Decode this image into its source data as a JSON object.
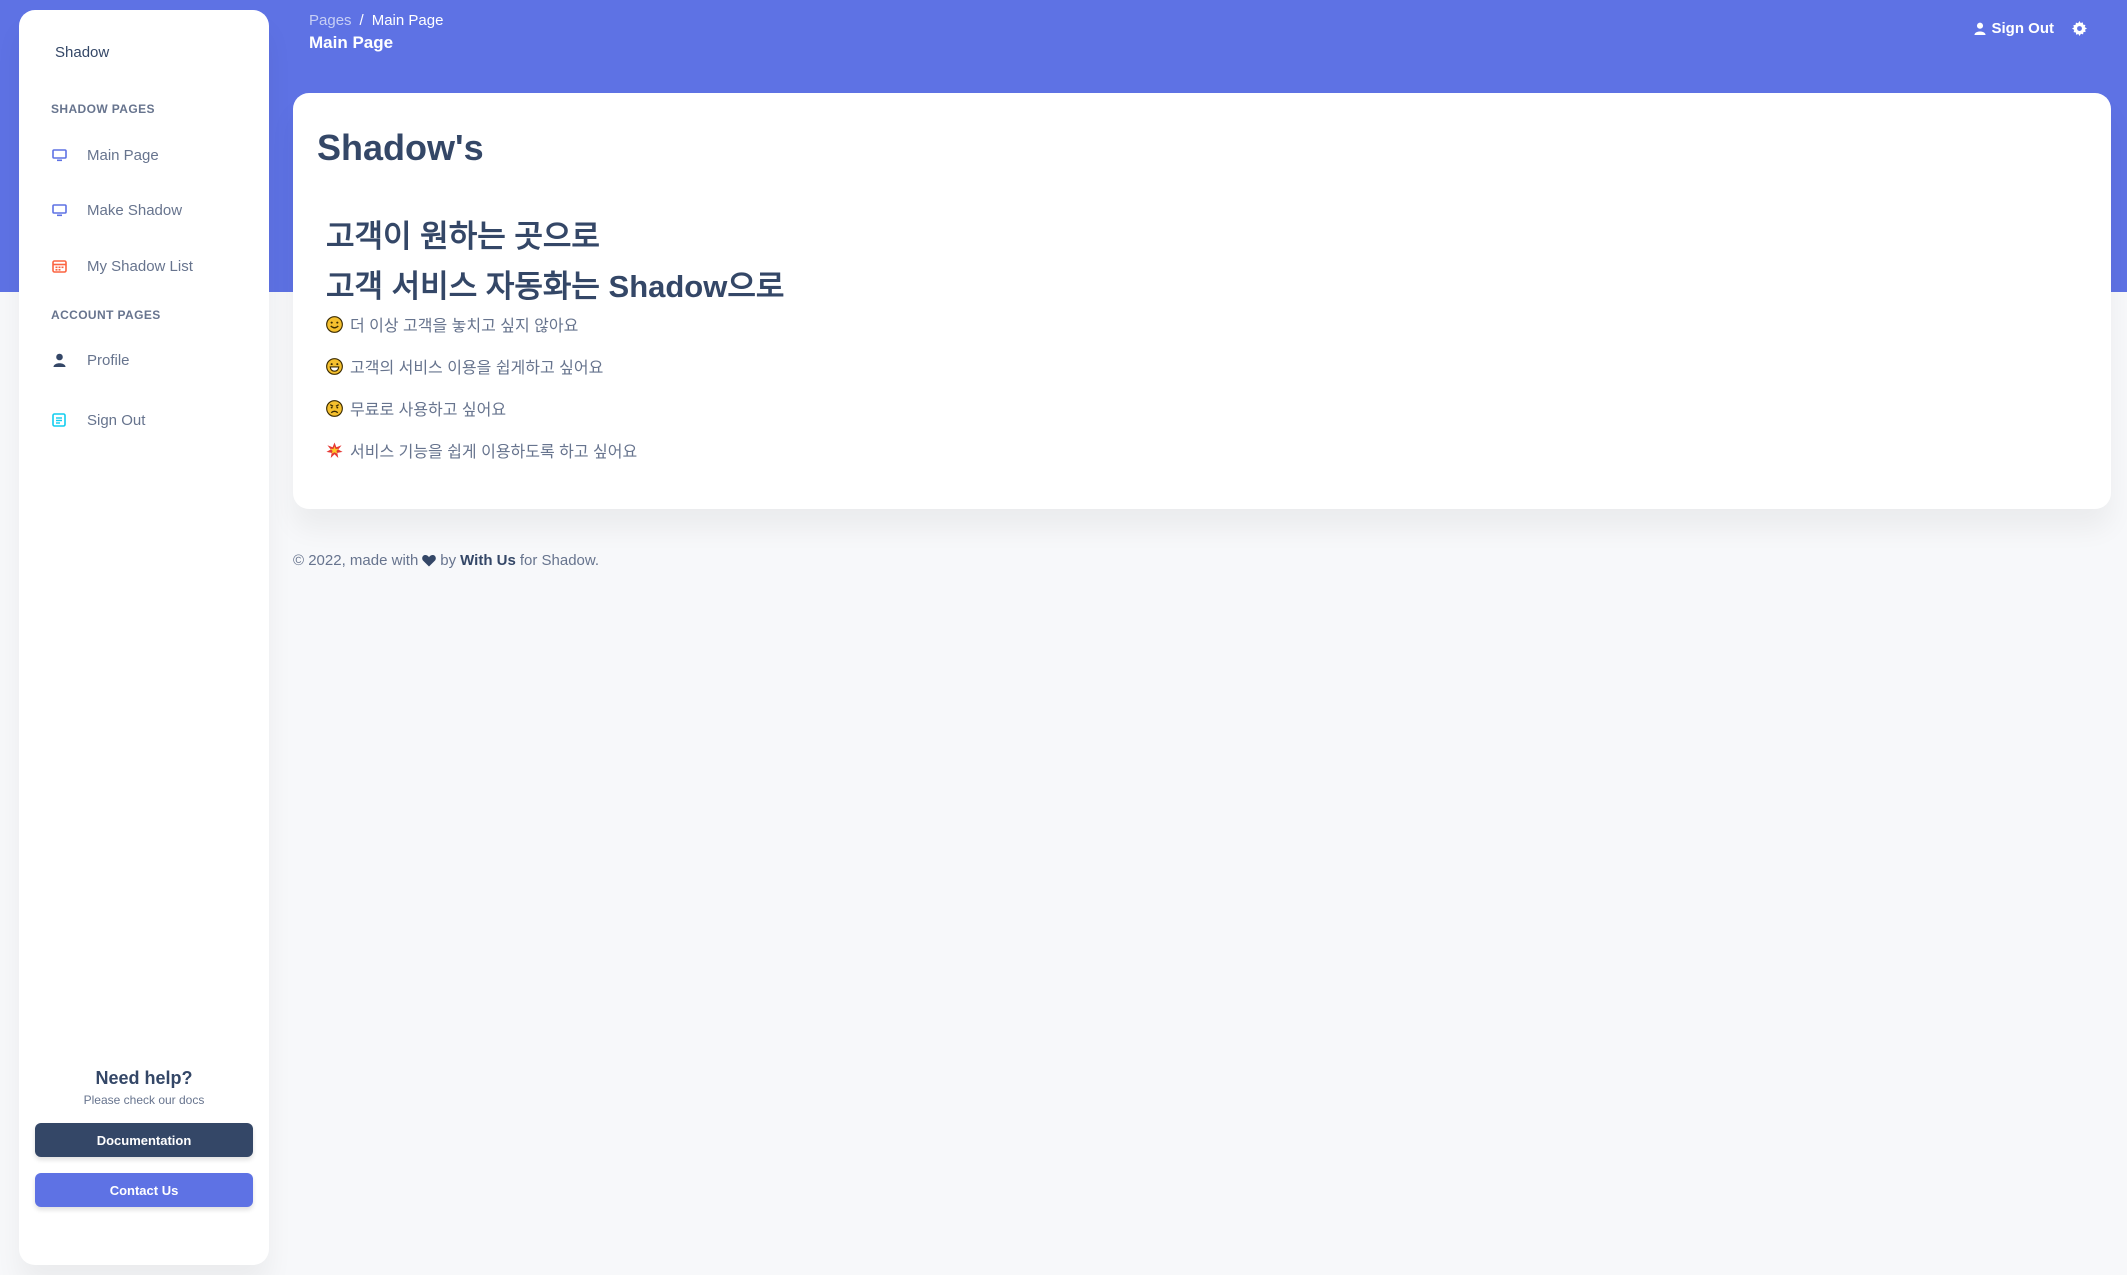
{
  "sidebar": {
    "brand": "Shadow",
    "section_shadow": "SHADOW PAGES",
    "items": [
      {
        "label": "Main Page",
        "icon": "monitor-icon"
      },
      {
        "label": "Make Shadow",
        "icon": "monitor-icon"
      },
      {
        "label": "My Shadow List",
        "icon": "calendar-icon"
      }
    ],
    "section_account": "ACCOUNT PAGES",
    "account_items": [
      {
        "label": "Profile",
        "icon": "user-icon"
      },
      {
        "label": "Sign Out",
        "icon": "document-icon"
      }
    ],
    "help_title": "Need help?",
    "help_sub": "Please check our docs",
    "doc_button": "Documentation",
    "contact_button": "Contact Us"
  },
  "header": {
    "breadcrumb_root": "Pages",
    "breadcrumb_sep": "/",
    "breadcrumb_current": "Main Page",
    "title": "Main Page",
    "signout": "Sign Out"
  },
  "main": {
    "title": "Shadow's",
    "headline_1": "고객이 원하는 곳으로",
    "headline_2": "고객 서비스 자동화는 Shadow으로",
    "features": [
      {
        "emoji": "smile-face-icon",
        "text": "더 이상 고객을 놓치고 싶지 않아요"
      },
      {
        "emoji": "grin-face-icon",
        "text": "고객의 서비스 이용을 쉽게하고 싶어요"
      },
      {
        "emoji": "angry-face-icon",
        "text": "무료로 사용하고 싶어요"
      },
      {
        "emoji": "collision-icon",
        "text": "서비스 기능을 쉽게 이용하도록 하고 싶어요"
      }
    ]
  },
  "footer": {
    "prefix": "© 2022, made with",
    "by": "by",
    "author": "With Us",
    "suffix": "for Shadow."
  },
  "colors": {
    "primary": "#5e72e4",
    "dark": "#344767",
    "text": "#67748e",
    "background": "#f7f8fa"
  }
}
